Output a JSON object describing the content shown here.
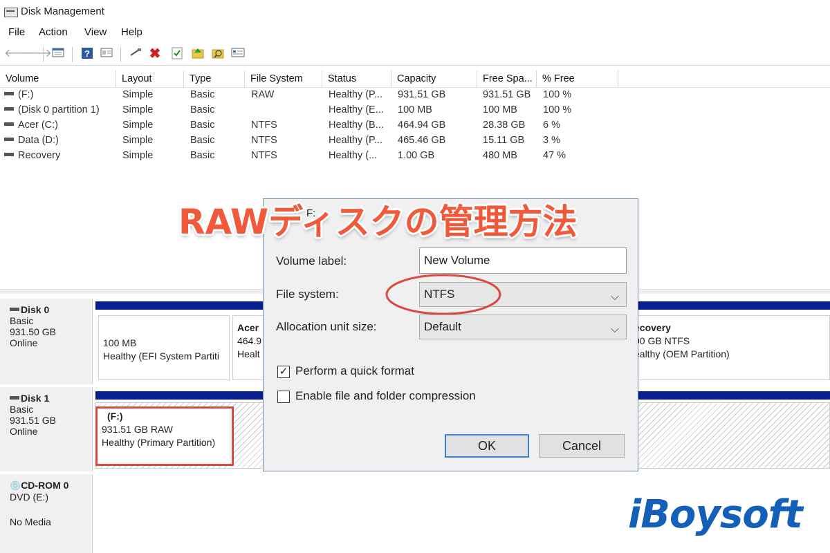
{
  "window": {
    "title": "Disk Management"
  },
  "menu": [
    "File",
    "Action",
    "View",
    "Help"
  ],
  "toolbar": {
    "icons": [
      "back-arrow-icon",
      "forward-arrow-icon",
      "list-view-icon",
      "help-icon",
      "properties-icon",
      "connect-icon",
      "delete-icon",
      "check-icon",
      "rescan-icon",
      "search-icon",
      "details-icon"
    ]
  },
  "volume_table": {
    "columns": [
      "Volume",
      "Layout",
      "Type",
      "File System",
      "Status",
      "Capacity",
      "Free Spa...",
      "% Free"
    ],
    "rows": [
      [
        "(F:)",
        "Simple",
        "Basic",
        "RAW",
        "Healthy (P...",
        "931.51 GB",
        "931.51 GB",
        "100 %"
      ],
      [
        "(Disk 0 partition 1)",
        "Simple",
        "Basic",
        "",
        "Healthy (E...",
        "100 MB",
        "100 MB",
        "100 %"
      ],
      [
        "Acer (C:)",
        "Simple",
        "Basic",
        "NTFS",
        "Healthy (B...",
        "464.94 GB",
        "28.38 GB",
        "6 %"
      ],
      [
        "Data (D:)",
        "Simple",
        "Basic",
        "NTFS",
        "Healthy (P...",
        "465.46 GB",
        "15.11 GB",
        "3 %"
      ],
      [
        "Recovery",
        "Simple",
        "Basic",
        "NTFS",
        "Healthy (...",
        "1.00 GB",
        "480 MB",
        "47 %"
      ]
    ]
  },
  "disks": {
    "disk0": {
      "name": "Disk 0",
      "type": "Basic",
      "size": "931.50 GB",
      "state": "Online",
      "p1": {
        "size": "100 MB",
        "status": "Healthy (EFI System Partiti"
      },
      "p2": {
        "name": "Acer",
        "size": "464.9",
        "status": "Healt"
      },
      "p3": {
        "name": "ecovery",
        "size": "00 GB NTFS",
        "status": "ealthy (OEM Partition)"
      }
    },
    "disk1": {
      "name": "Disk 1",
      "type": "Basic",
      "size": "931.51 GB",
      "state": "Online",
      "p1": {
        "name": "(F:)",
        "size": "931.51 GB RAW",
        "status": "Healthy (Primary Partition)"
      }
    },
    "cdrom0": {
      "name": "CD-ROM 0",
      "type": "DVD (E:)",
      "state": "No Media"
    }
  },
  "dialog": {
    "title": "F:",
    "volume_label_label": "Volume label:",
    "volume_label_value": "New Volume",
    "file_system_label": "File system:",
    "file_system_value": "NTFS",
    "alloc_label": "Allocation unit size:",
    "alloc_value": "Default",
    "quick_format_label": "Perform a quick format",
    "quick_format_checked": true,
    "compression_label": "Enable file and folder compression",
    "compression_checked": false,
    "ok_label": "OK",
    "cancel_label": "Cancel"
  },
  "overlay": {
    "title": "RAWディスクの管理方法"
  },
  "watermark": {
    "text": "iBoysoft"
  },
  "colors": {
    "highlight": "#d9493f",
    "disk_bar": "#0a1f8f",
    "overlay_text": "#f0593a",
    "watermark": "#1460b8"
  }
}
